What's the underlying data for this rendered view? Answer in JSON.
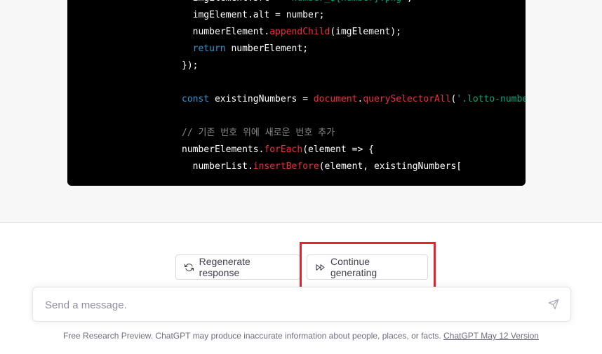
{
  "code": {
    "lines": [
      [
        {
          "t": "  imgElement.src = ",
          "c": ""
        },
        {
          "t": "`number_${number}.png`",
          "c": "str"
        },
        {
          "t": ";",
          "c": ""
        }
      ],
      [
        {
          "t": "  imgElement.alt = number;",
          "c": ""
        }
      ],
      [
        {
          "t": "  numberElement.",
          "c": ""
        },
        {
          "t": "appendChild",
          "c": "fn"
        },
        {
          "t": "(imgElement);",
          "c": ""
        }
      ],
      [
        {
          "t": "  ",
          "c": ""
        },
        {
          "t": "return",
          "c": "kw"
        },
        {
          "t": " numberElement;",
          "c": ""
        }
      ],
      [
        {
          "t": "});",
          "c": ""
        }
      ],
      [
        {
          "t": "",
          "c": ""
        }
      ],
      [
        {
          "t": "const",
          "c": "kw"
        },
        {
          "t": " existingNumbers = ",
          "c": ""
        },
        {
          "t": "document",
          "c": "fn"
        },
        {
          "t": ".",
          "c": ""
        },
        {
          "t": "querySelectorAll",
          "c": "fn"
        },
        {
          "t": "(",
          "c": ""
        },
        {
          "t": "'.lotto-number'",
          "c": "str"
        },
        {
          "t": ");",
          "c": ""
        }
      ],
      [
        {
          "t": "",
          "c": ""
        }
      ],
      [
        {
          "t": "// 기존 번호 위에 새로운 번호 추가",
          "c": "cmt"
        }
      ],
      [
        {
          "t": "numberElements.",
          "c": ""
        },
        {
          "t": "forEach",
          "c": "fn"
        },
        {
          "t": "(element => {",
          "c": ""
        }
      ],
      [
        {
          "t": "  numberList.",
          "c": ""
        },
        {
          "t": "insertBefore",
          "c": "fn"
        },
        {
          "t": "(element, existingNumbers[",
          "c": ""
        }
      ]
    ]
  },
  "actions": {
    "regenerate_label": "Regenerate response",
    "regenerate_icon": "refresh-icon",
    "continue_label": "Continue generating",
    "continue_icon": "fast-forward-icon"
  },
  "composer": {
    "placeholder": "Send a message.",
    "value": "",
    "send_icon": "send-icon"
  },
  "footer": {
    "text": "Free Research Preview. ChatGPT may produce inaccurate information about people, places, or facts. ",
    "link": "ChatGPT May 12 Version"
  },
  "colors": {
    "highlight": "#e3242b",
    "code_bg": "#000000",
    "keyword": "#2e95d3",
    "function": "#f22c3d",
    "string": "#00a67d"
  }
}
